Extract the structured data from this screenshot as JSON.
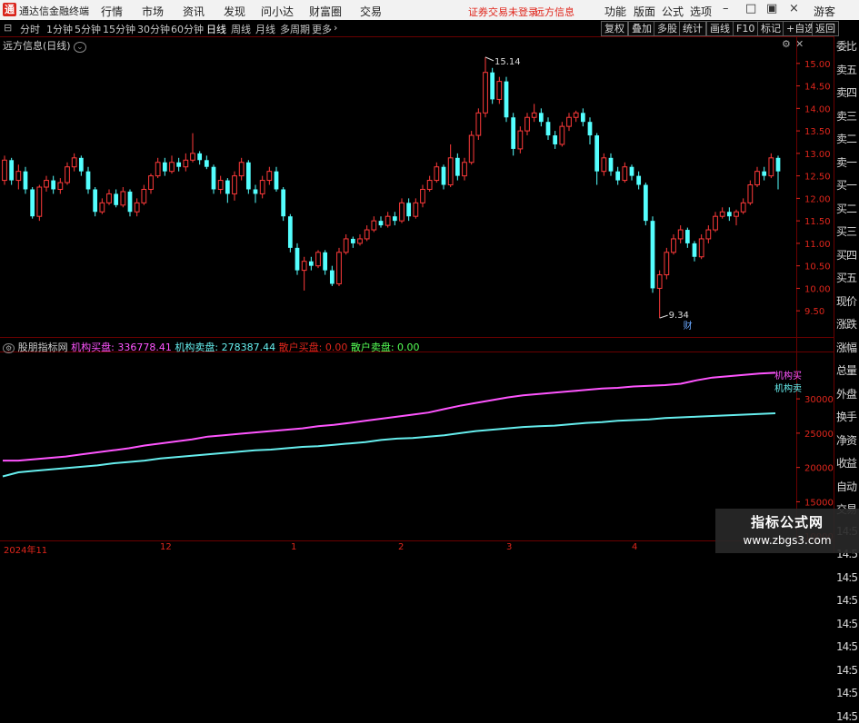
{
  "titlebar": {
    "app_title": "通达信金融终端",
    "menus": [
      "行情",
      "市场",
      "资讯",
      "发现",
      "问小达",
      "财富圈",
      "交易"
    ],
    "warning": "证券交易未登录",
    "stock_name": "远方信息",
    "tools": [
      "功能",
      "版面",
      "公式",
      "选项"
    ],
    "guest": "游客"
  },
  "periodbar": {
    "items": [
      "分时",
      "1分钟",
      "5分钟",
      "15分钟",
      "30分钟",
      "60分钟",
      "日线",
      "周线",
      "月线",
      "多周期",
      "更多"
    ],
    "active": "日线",
    "right_buttons": [
      "复权",
      "叠加",
      "多股",
      "统计",
      "画线",
      "F10",
      "标记",
      "+自选",
      "返回"
    ]
  },
  "chart_label": "远方信息(日线)",
  "right_panel": [
    "委比",
    "卖五",
    "卖四",
    "卖三",
    "卖二",
    "卖一",
    "买一",
    "买二",
    "买三",
    "买四",
    "买五",
    "现价",
    "涨跌",
    "涨幅",
    "总量",
    "外盘",
    "换手",
    "净资",
    "收益",
    "自动",
    "交易",
    "14:5",
    "14:5",
    "14:5",
    "14:5",
    "14:5",
    "14:5",
    "14:5",
    "14:5",
    "14:5"
  ],
  "indicator": {
    "name": "股朋指标网",
    "items": [
      {
        "label": "机构买盘:",
        "value": "336778.41",
        "color": "#ff55ff"
      },
      {
        "label": "机构卖盘:",
        "value": "278387.44",
        "color": "#66eeee"
      },
      {
        "label": "散户买盘:",
        "value": "0.00",
        "color": "#e0261c"
      },
      {
        "label": "散户卖盘:",
        "value": "0.00",
        "color": "#55ff55"
      }
    ],
    "line_tags": [
      "机构买",
      "机构卖"
    ]
  },
  "date_axis": [
    "2024年11",
    "12",
    "1",
    "2",
    "3",
    "4"
  ],
  "watermark": {
    "line1": "指标公式网",
    "line2": "www.zbgs3.com"
  },
  "colors": {
    "up": "#ff3a3a",
    "down": "#54ffff",
    "buy": "#ff55ff",
    "sell": "#66eeee",
    "axis": "#e0261c",
    "grid": "#6a0000"
  },
  "chart_data": [
    {
      "type": "candlestick",
      "title": "远方信息(日线)",
      "ylim": [
        9.1,
        15.4
      ],
      "y_ticks": [
        15.0,
        14.5,
        14.0,
        13.5,
        13.0,
        12.5,
        12.0,
        11.5,
        11.0,
        10.5,
        10.0,
        9.5
      ],
      "annotations": [
        {
          "text": "15.14",
          "y": 15.14
        },
        {
          "text": "9.34",
          "y": 9.34
        },
        {
          "text": "财"
        }
      ],
      "candles": [
        [
          12.4,
          12.85,
          12.95,
          12.3
        ],
        [
          12.85,
          12.4,
          12.9,
          12.3
        ],
        [
          12.4,
          12.6,
          12.75,
          12.2
        ],
        [
          12.6,
          12.2,
          12.7,
          12.1
        ],
        [
          12.2,
          11.6,
          12.25,
          11.55
        ],
        [
          11.6,
          12.25,
          12.3,
          11.5
        ],
        [
          12.25,
          12.4,
          12.5,
          12.15
        ],
        [
          12.4,
          12.2,
          12.5,
          12.1
        ],
        [
          12.2,
          12.35,
          12.45,
          12.1
        ],
        [
          12.35,
          12.7,
          12.8,
          12.3
        ],
        [
          12.7,
          12.9,
          13.0,
          12.6
        ],
        [
          12.9,
          12.6,
          12.95,
          12.5
        ],
        [
          12.6,
          12.2,
          12.7,
          12.1
        ],
        [
          12.2,
          11.7,
          12.25,
          11.6
        ],
        [
          11.7,
          11.9,
          12.0,
          11.65
        ],
        [
          11.9,
          12.1,
          12.2,
          11.85
        ],
        [
          12.1,
          11.85,
          12.2,
          11.8
        ],
        [
          11.85,
          12.15,
          12.25,
          11.8
        ],
        [
          12.15,
          11.7,
          12.2,
          11.6
        ],
        [
          11.7,
          11.9,
          12.0,
          11.6
        ],
        [
          11.9,
          12.2,
          12.3,
          11.85
        ],
        [
          12.2,
          12.5,
          12.55,
          12.1
        ],
        [
          12.5,
          12.8,
          12.9,
          12.45
        ],
        [
          12.8,
          12.6,
          12.9,
          12.5
        ],
        [
          12.6,
          12.8,
          12.95,
          12.55
        ],
        [
          12.8,
          12.7,
          12.9,
          12.6
        ],
        [
          12.7,
          12.85,
          13.0,
          12.6
        ],
        [
          12.85,
          13.0,
          13.45,
          12.8
        ],
        [
          13.0,
          12.85,
          13.05,
          12.75
        ],
        [
          12.85,
          12.7,
          12.95,
          12.65
        ],
        [
          12.7,
          12.2,
          12.75,
          12.1
        ],
        [
          12.2,
          12.4,
          12.5,
          12.1
        ],
        [
          12.4,
          12.1,
          12.45,
          11.9
        ],
        [
          12.1,
          12.5,
          12.6,
          11.95
        ],
        [
          12.5,
          12.8,
          12.9,
          12.4
        ],
        [
          12.8,
          12.2,
          12.85,
          12.1
        ],
        [
          12.2,
          12.1,
          12.3,
          11.9
        ],
        [
          12.1,
          12.4,
          12.5,
          12.0
        ],
        [
          12.4,
          12.6,
          12.7,
          12.3
        ],
        [
          12.6,
          12.2,
          12.7,
          12.15
        ],
        [
          12.2,
          11.6,
          12.25,
          11.5
        ],
        [
          11.6,
          10.9,
          11.65,
          10.8
        ],
        [
          10.9,
          10.4,
          11.0,
          10.3
        ],
        [
          10.4,
          10.6,
          10.7,
          9.95
        ],
        [
          10.6,
          10.5,
          10.7,
          10.4
        ],
        [
          10.5,
          10.8,
          10.85,
          10.45
        ],
        [
          10.8,
          10.4,
          10.85,
          10.3
        ],
        [
          10.4,
          10.1,
          10.5,
          10.05
        ],
        [
          10.1,
          10.8,
          10.9,
          10.05
        ],
        [
          10.8,
          11.1,
          11.2,
          10.75
        ],
        [
          11.1,
          11.0,
          11.15,
          10.9
        ],
        [
          11.0,
          11.1,
          11.2,
          10.95
        ],
        [
          11.1,
          11.3,
          11.4,
          11.05
        ],
        [
          11.3,
          11.5,
          11.6,
          11.25
        ],
        [
          11.5,
          11.4,
          11.6,
          11.35
        ],
        [
          11.4,
          11.6,
          11.7,
          11.35
        ],
        [
          11.6,
          11.5,
          11.7,
          11.4
        ],
        [
          11.5,
          11.9,
          12.0,
          11.45
        ],
        [
          11.9,
          11.6,
          12.0,
          11.5
        ],
        [
          11.6,
          11.9,
          12.0,
          11.55
        ],
        [
          11.9,
          12.2,
          12.3,
          11.8
        ],
        [
          12.2,
          12.4,
          12.5,
          12.15
        ],
        [
          12.4,
          12.7,
          12.8,
          12.35
        ],
        [
          12.7,
          12.3,
          12.75,
          12.2
        ],
        [
          12.3,
          12.9,
          13.2,
          12.25
        ],
        [
          12.9,
          12.5,
          13.0,
          12.4
        ],
        [
          12.5,
          12.8,
          12.9,
          12.4
        ],
        [
          12.8,
          13.4,
          13.5,
          12.75
        ],
        [
          13.4,
          13.9,
          14.0,
          13.3
        ],
        [
          13.9,
          14.8,
          15.14,
          13.8
        ],
        [
          14.8,
          14.2,
          14.9,
          14.1
        ],
        [
          14.2,
          14.6,
          14.7,
          14.1
        ],
        [
          14.6,
          13.8,
          14.7,
          13.7
        ],
        [
          13.8,
          13.1,
          13.9,
          12.95
        ],
        [
          13.1,
          13.5,
          13.6,
          13.0
        ],
        [
          13.5,
          13.8,
          13.9,
          13.4
        ],
        [
          13.8,
          13.9,
          14.1,
          13.7
        ],
        [
          13.9,
          13.7,
          14.0,
          13.6
        ],
        [
          13.7,
          13.4,
          13.8,
          13.3
        ],
        [
          13.4,
          13.2,
          13.5,
          13.1
        ],
        [
          13.2,
          13.6,
          13.7,
          13.15
        ],
        [
          13.6,
          13.8,
          13.9,
          13.5
        ],
        [
          13.8,
          13.9,
          13.95,
          13.7
        ],
        [
          13.9,
          13.7,
          14.0,
          13.6
        ],
        [
          13.7,
          13.4,
          13.8,
          13.2
        ],
        [
          13.4,
          12.6,
          13.45,
          12.3
        ],
        [
          12.6,
          12.9,
          13.0,
          12.5
        ],
        [
          12.9,
          12.6,
          13.0,
          12.5
        ],
        [
          12.6,
          12.4,
          12.7,
          12.3
        ],
        [
          12.4,
          12.7,
          12.8,
          12.35
        ],
        [
          12.7,
          12.5,
          12.75,
          12.4
        ],
        [
          12.5,
          12.3,
          12.6,
          12.2
        ],
        [
          12.3,
          11.5,
          12.35,
          11.4
        ],
        [
          11.5,
          10.0,
          11.6,
          9.9
        ],
        [
          10.0,
          10.3,
          10.4,
          9.34
        ],
        [
          10.3,
          10.8,
          10.9,
          10.2
        ],
        [
          10.8,
          11.1,
          11.2,
          10.75
        ],
        [
          11.1,
          11.3,
          11.4,
          11.0
        ],
        [
          11.3,
          11.0,
          11.35,
          10.9
        ],
        [
          11.0,
          10.7,
          11.05,
          10.6
        ],
        [
          10.7,
          11.1,
          11.2,
          10.65
        ],
        [
          11.1,
          11.3,
          11.4,
          11.0
        ],
        [
          11.3,
          11.6,
          11.7,
          11.25
        ],
        [
          11.6,
          11.7,
          11.8,
          11.55
        ],
        [
          11.7,
          11.6,
          11.8,
          11.5
        ],
        [
          11.6,
          11.7,
          11.75,
          11.4
        ],
        [
          11.7,
          11.9,
          12.0,
          11.65
        ],
        [
          11.9,
          12.3,
          12.4,
          11.85
        ],
        [
          12.3,
          12.6,
          12.7,
          12.25
        ],
        [
          12.6,
          12.5,
          12.7,
          12.4
        ],
        [
          12.5,
          12.9,
          13.0,
          12.45
        ],
        [
          12.9,
          12.6,
          12.95,
          12.2
        ]
      ]
    },
    {
      "type": "line",
      "ylim": [
        9500,
        36500
      ],
      "y_ticks": [
        30000,
        25000,
        20000,
        15000,
        10000
      ],
      "series": [
        {
          "name": "机构买",
          "color": "#ff55ff",
          "values": [
            21000,
            21000,
            21200,
            21400,
            21600,
            21900,
            22200,
            22500,
            22800,
            23200,
            23500,
            23800,
            24100,
            24500,
            24700,
            24900,
            25100,
            25300,
            25500,
            25700,
            26000,
            26200,
            26500,
            26800,
            27100,
            27400,
            27700,
            28000,
            28500,
            29000,
            29400,
            29800,
            30200,
            30500,
            30700,
            30900,
            31100,
            31300,
            31500,
            31600,
            31800,
            31900,
            32000,
            32200,
            32700,
            33100,
            33300,
            33500,
            33700,
            33800
          ]
        },
        {
          "name": "机构卖",
          "color": "#66eeee",
          "values": [
            18700,
            19300,
            19500,
            19700,
            19900,
            20100,
            20300,
            20600,
            20800,
            21000,
            21300,
            21500,
            21700,
            21900,
            22100,
            22300,
            22500,
            22600,
            22800,
            23000,
            23100,
            23300,
            23500,
            23700,
            24000,
            24200,
            24300,
            24500,
            24700,
            25000,
            25300,
            25500,
            25700,
            25900,
            26000,
            26100,
            26300,
            26500,
            26600,
            26800,
            26900,
            27000,
            27200,
            27300,
            27400,
            27500,
            27600,
            27700,
            27800,
            27900
          ]
        }
      ]
    }
  ]
}
